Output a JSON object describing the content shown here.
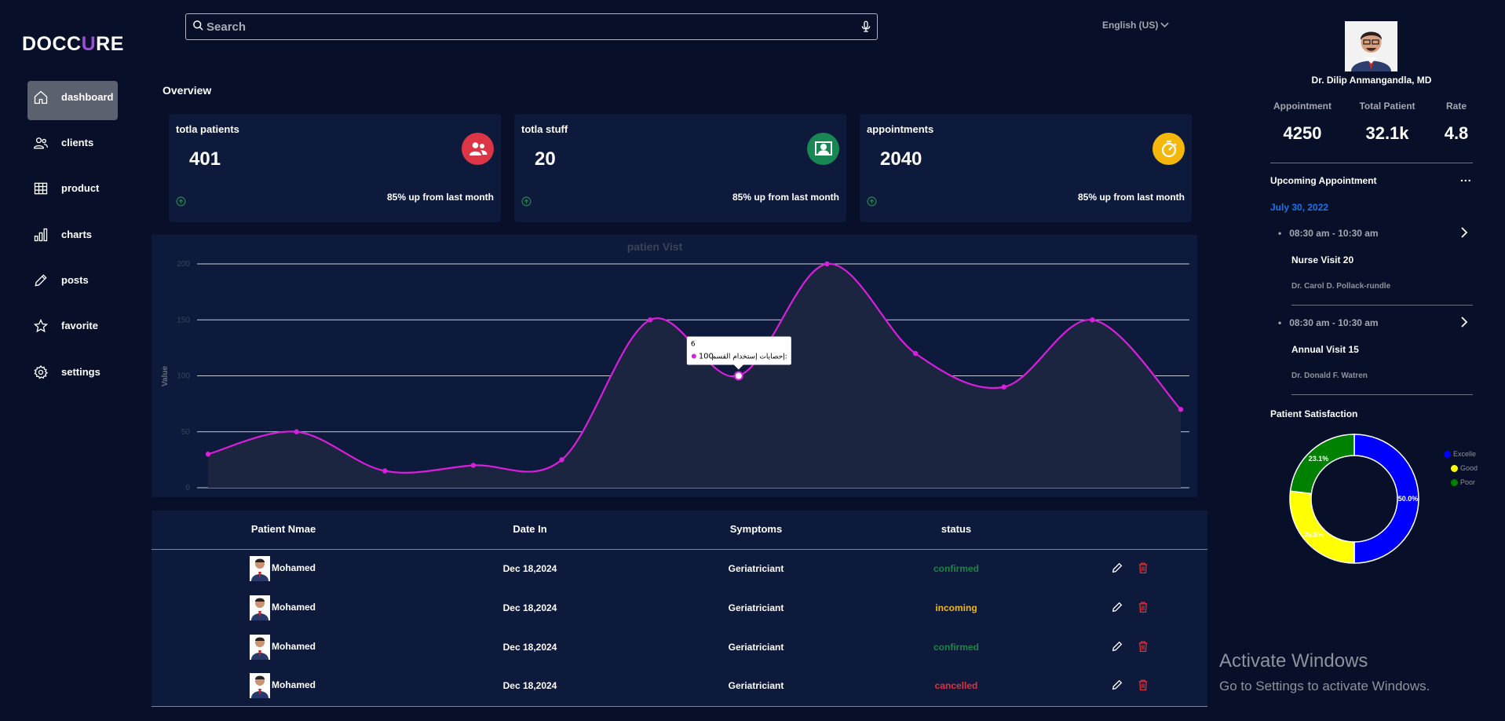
{
  "app": {
    "logo_text_a": "DOCC",
    "logo_text_u": "U",
    "logo_text_b": "RE"
  },
  "sidebar": {
    "items": [
      {
        "label": "dashboard",
        "icon": "home-icon",
        "active": true
      },
      {
        "label": "clients",
        "icon": "users-icon"
      },
      {
        "label": "product",
        "icon": "table-icon"
      },
      {
        "label": "charts",
        "icon": "bar-chart-icon"
      },
      {
        "label": "posts",
        "icon": "pencil-icon"
      },
      {
        "label": "favorite",
        "icon": "star-icon"
      },
      {
        "label": "settings",
        "icon": "gear-icon"
      }
    ]
  },
  "header": {
    "search_placeholder": "Search",
    "language": "English (US)"
  },
  "overview": {
    "title": "Overview",
    "cards": [
      {
        "title": "totla patients",
        "value": "401",
        "sub": "85% up from last month",
        "icon": "patients-icon",
        "color": "#dc3545"
      },
      {
        "title": "totla stuff",
        "value": "20",
        "sub": "85% up from last month",
        "icon": "staff-icon",
        "color": "#198754"
      },
      {
        "title": "appointments",
        "value": "2040",
        "sub": "85% up from last month",
        "icon": "timer-icon",
        "color": "#f5b80a"
      }
    ]
  },
  "chart_data": {
    "type": "area",
    "title": "patien Vist",
    "ylabel": "Value",
    "ylim": [
      0,
      200
    ],
    "y_ticks": [
      "0",
      "50",
      "100",
      "150",
      "200"
    ],
    "x": [
      0,
      1,
      2,
      3,
      4,
      5,
      6,
      7,
      8,
      9,
      10,
      11,
      12
    ],
    "series": [
      {
        "values": [
          30,
          50,
          15,
          20,
          25,
          150,
          100,
          200,
          120,
          90,
          150,
          70
        ],
        "color": "#d81fdc"
      }
    ],
    "tooltip": {
      "index": 6,
      "header": "6",
      "value": "100",
      "label": "إحصايات إستخدام القسم"
    },
    "grid": true
  },
  "table": {
    "headers": [
      "Patient Nmae",
      "Date In",
      "Symptoms",
      "status"
    ],
    "rows": [
      {
        "name": "Mohamed",
        "date": "Dec 18,2024",
        "symptom": "Geriatriciant",
        "status": "confirmed",
        "status_color": "#1e8449"
      },
      {
        "name": "Mohamed",
        "date": "Dec 18,2024",
        "symptom": "Geriatriciant",
        "status": "incoming",
        "status_color": "#f5b80a"
      },
      {
        "name": "Mohamed",
        "date": "Dec 18,2024",
        "symptom": "Geriatriciant",
        "status": "confirmed",
        "status_color": "#1e8449"
      },
      {
        "name": "Mohamed",
        "date": "Dec 18,2024",
        "symptom": "Geriatriciant",
        "status": "cancelled",
        "status_color": "#e0303a"
      }
    ]
  },
  "profile": {
    "name": "Dr. Dilip Anmangandla, MD",
    "stats": [
      {
        "label": "Appointment",
        "value": "4250"
      },
      {
        "label": "Total Patient",
        "value": "32.1k"
      },
      {
        "label": "Rate",
        "value": "4.8"
      }
    ]
  },
  "upcoming": {
    "title": "Upcoming Appointment",
    "more": "...",
    "date": "July 30, 2022",
    "items": [
      {
        "time": "08:30 am - 10:30 am",
        "title": "Nurse Visit 20",
        "doctor": "Dr. Carol D. Pollack-rundle"
      },
      {
        "time": "08:30 am - 10:30 am",
        "title": "Annual Visit 15",
        "doctor": "Dr. Donald F. Watren"
      }
    ]
  },
  "satisfaction": {
    "title": "Patient Satisfaction",
    "chart_data": {
      "type": "pie",
      "labels": [
        "Excellent",
        "Good",
        "Poor"
      ],
      "legend_labels": [
        "Excelle",
        "Good",
        "Poor"
      ],
      "values": [
        50.0,
        26.9,
        23.1
      ],
      "value_labels": [
        "50.0%",
        "26.9%",
        "23.1%"
      ],
      "colors": [
        "#0000ff",
        "#ffff00",
        "#008000"
      ]
    }
  },
  "watermark": {
    "title": "Activate Windows",
    "subtitle": "Go to Settings to activate Windows."
  }
}
